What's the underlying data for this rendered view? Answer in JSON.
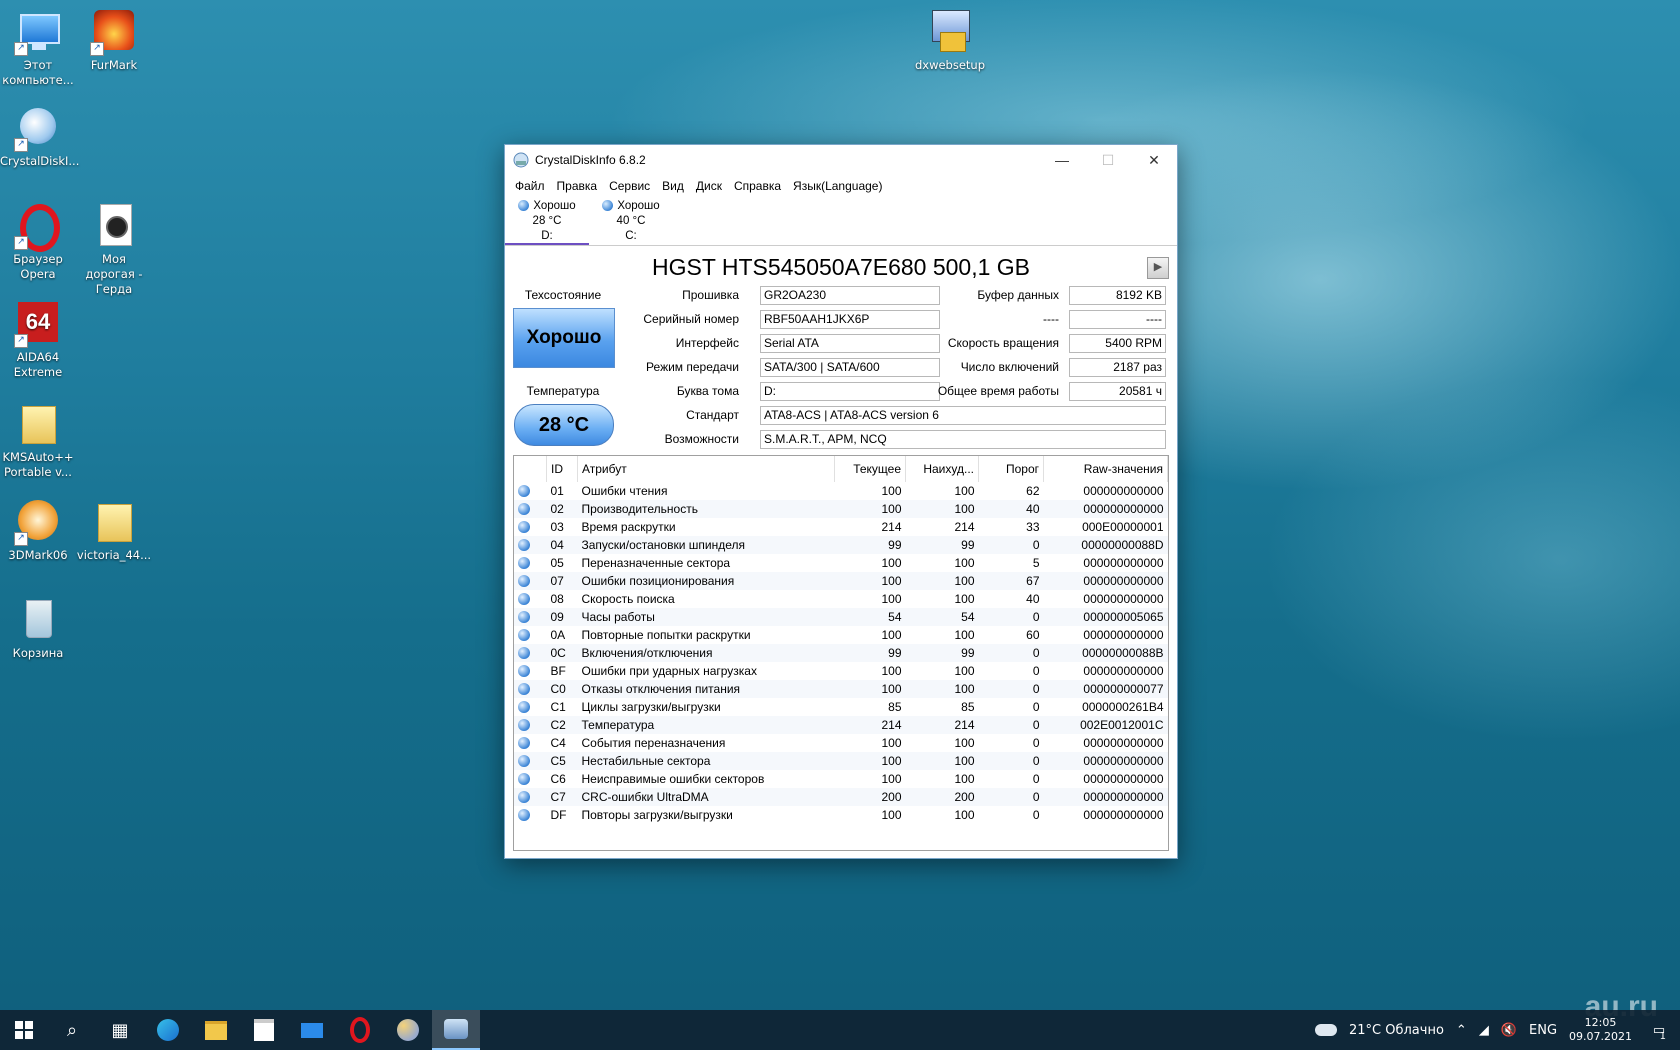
{
  "desktop": {
    "icons": [
      {
        "label": "Этот компьюте...",
        "icon": "computer-icon"
      },
      {
        "label": "FurMark",
        "icon": "furmark-icon"
      },
      {
        "label": "CrystalDiskI...",
        "icon": "crystaldiskinfo-icon"
      },
      {
        "label": "Браузер Opera",
        "icon": "opera-icon"
      },
      {
        "label": "Моя дорогая - Герда",
        "icon": "music-file-icon"
      },
      {
        "label": "AIDA64 Extreme",
        "icon": "aida64-icon"
      },
      {
        "label": "KMSAuto++ Portable v...",
        "icon": "folder-icon"
      },
      {
        "label": "3DMark06",
        "icon": "3dmark-icon"
      },
      {
        "label": "victoria_44...",
        "icon": "folder-icon"
      },
      {
        "label": "Корзина",
        "icon": "recycle-bin-icon"
      },
      {
        "label": "dxwebsetup",
        "icon": "setup-icon"
      }
    ]
  },
  "window": {
    "title": "CrystalDiskInfo 6.8.2",
    "menu": [
      "Файл",
      "Правка",
      "Сервис",
      "Вид",
      "Диск",
      "Справка",
      "Язык(Language)"
    ],
    "drives": [
      {
        "status": "Хорошо",
        "temp": "28 °C",
        "letter": "D:"
      },
      {
        "status": "Хорошо",
        "temp": "40 °C",
        "letter": "C:"
      }
    ],
    "disk_title": "HGST HTS545050A7E680 500,1 GB",
    "health_label": "Техсостояние",
    "health_value": "Хорошо",
    "temp_label": "Температура",
    "temp_value": "28 °C",
    "fields": {
      "firmware_label": "Прошивка",
      "firmware": "GR2OA230",
      "serial_label": "Серийный номер",
      "serial": "RBF50AAH1JKX6P",
      "interface_label": "Интерфейс",
      "interface": "Serial ATA",
      "transfer_label": "Режим передачи",
      "transfer": "SATA/300 | SATA/600",
      "volume_label": "Буква тома",
      "volume": "D:",
      "standard_label": "Стандарт",
      "standard": "ATA8-ACS | ATA8-ACS version 6",
      "features_label": "Возможности",
      "features": "S.M.A.R.T., APM, NCQ",
      "buffer_label": "Буфер данных",
      "buffer": "8192 KB",
      "blank_label": "----",
      "blank": "----",
      "rpm_label": "Скорость вращения",
      "rpm": "5400 RPM",
      "power_count_label": "Число включений",
      "power_count": "2187 раз",
      "power_hours_label": "Общее время работы",
      "power_hours": "20581 ч"
    },
    "table_headers": [
      "ID",
      "Атрибут",
      "Текущее",
      "Наихуд...",
      "Порог",
      "Raw-значения"
    ],
    "attributes": [
      [
        "01",
        "Ошибки чтения",
        "100",
        "100",
        "62",
        "000000000000"
      ],
      [
        "02",
        "Производительность",
        "100",
        "100",
        "40",
        "000000000000"
      ],
      [
        "03",
        "Время раскрутки",
        "214",
        "214",
        "33",
        "000E00000001"
      ],
      [
        "04",
        "Запуски/остановки шпинделя",
        "99",
        "99",
        "0",
        "00000000088D"
      ],
      [
        "05",
        "Переназначенные сектора",
        "100",
        "100",
        "5",
        "000000000000"
      ],
      [
        "07",
        "Ошибки позиционирования",
        "100",
        "100",
        "67",
        "000000000000"
      ],
      [
        "08",
        "Скорость поиска",
        "100",
        "100",
        "40",
        "000000000000"
      ],
      [
        "09",
        "Часы работы",
        "54",
        "54",
        "0",
        "000000005065"
      ],
      [
        "0A",
        "Повторные попытки раскрутки",
        "100",
        "100",
        "60",
        "000000000000"
      ],
      [
        "0C",
        "Включения/отключения",
        "99",
        "99",
        "0",
        "00000000088B"
      ],
      [
        "BF",
        "Ошибки при ударных нагрузках",
        "100",
        "100",
        "0",
        "000000000000"
      ],
      [
        "C0",
        "Отказы отключения питания",
        "100",
        "100",
        "0",
        "000000000077"
      ],
      [
        "C1",
        "Циклы загрузки/выгрузки",
        "85",
        "85",
        "0",
        "0000000261B4"
      ],
      [
        "C2",
        "Температура",
        "214",
        "214",
        "0",
        "002E0012001C"
      ],
      [
        "C4",
        "События переназначения",
        "100",
        "100",
        "0",
        "000000000000"
      ],
      [
        "C5",
        "Нестабильные сектора",
        "100",
        "100",
        "0",
        "000000000000"
      ],
      [
        "C6",
        "Неисправимые ошибки секторов",
        "100",
        "100",
        "0",
        "000000000000"
      ],
      [
        "C7",
        "CRC-ошибки UltraDMA",
        "200",
        "200",
        "0",
        "000000000000"
      ],
      [
        "DF",
        "Повторы загрузки/выгрузки",
        "100",
        "100",
        "0",
        "000000000000"
      ]
    ]
  },
  "taskbar": {
    "weather": "21°C  Облачно",
    "lang": "ENG",
    "time": "12:05",
    "date": "09.07.2021",
    "notifications": "1",
    "watermark": "au.ru"
  }
}
